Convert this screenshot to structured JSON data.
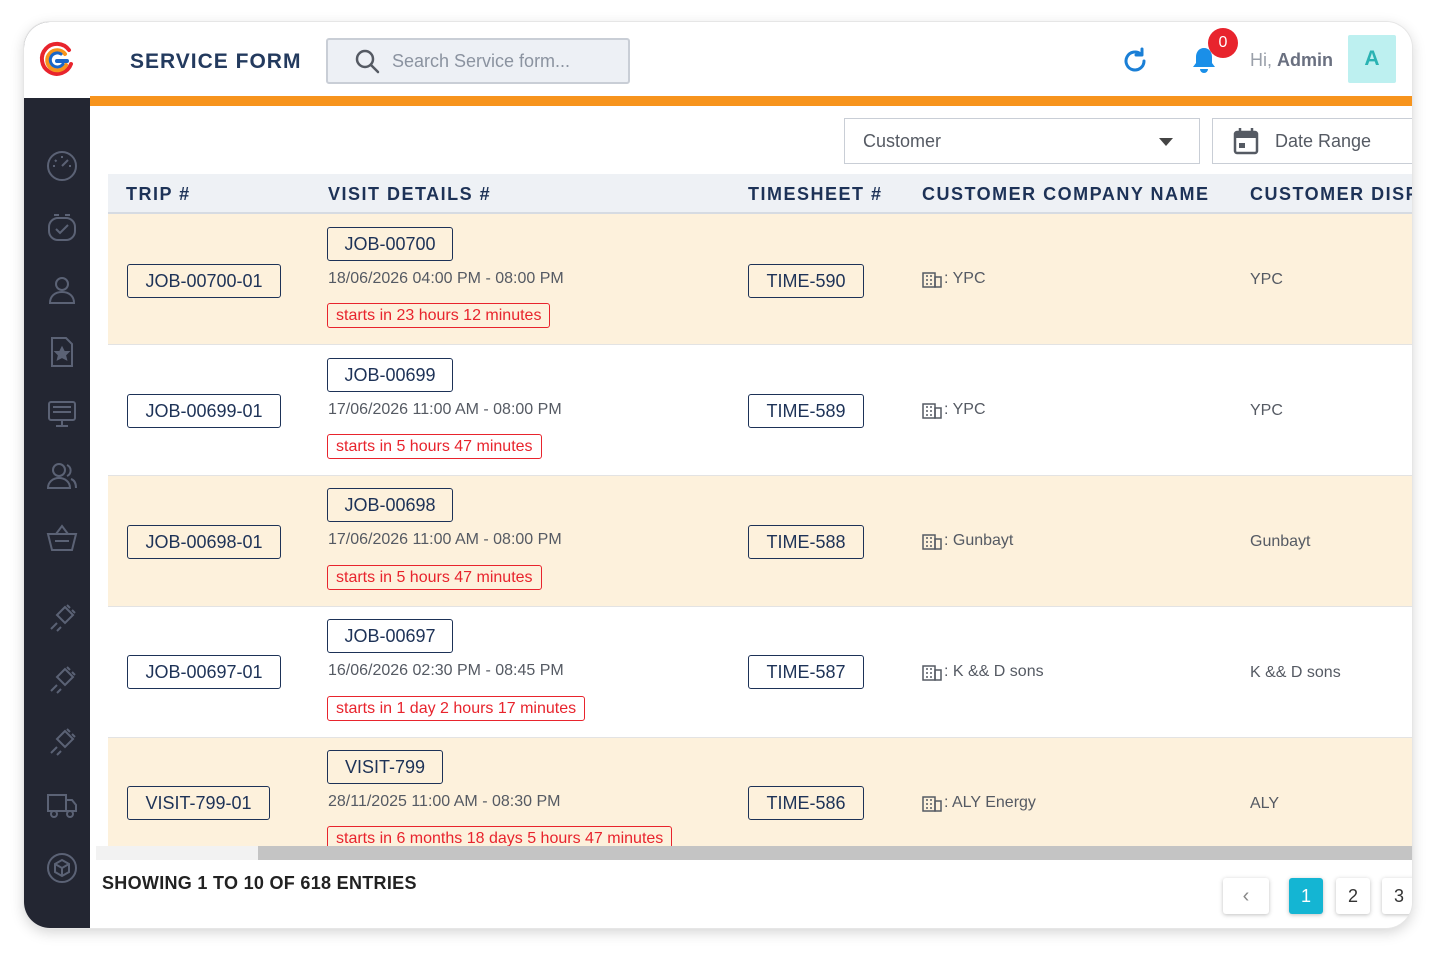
{
  "header": {
    "title": "SERVICE FORM",
    "search_placeholder": "Search Service form...",
    "notification_count": "0",
    "greeting": "Hi,",
    "user_name": "Admin",
    "avatar_letter": "A"
  },
  "sidebar": {
    "items": [
      {
        "icon": "dashboard-gauge-icon"
      },
      {
        "icon": "timer-check-icon"
      },
      {
        "icon": "user-icon"
      },
      {
        "icon": "star-document-icon"
      },
      {
        "icon": "monitor-icon"
      },
      {
        "icon": "users-icon"
      },
      {
        "icon": "basket-icon"
      },
      {
        "icon": "plug-icon"
      },
      {
        "icon": "plug-icon"
      },
      {
        "icon": "plug-icon"
      },
      {
        "icon": "truck-icon"
      },
      {
        "icon": "box-icon"
      }
    ]
  },
  "filters": {
    "customer_label": "Customer",
    "date_range_label": "Date Range"
  },
  "table": {
    "columns": [
      "TRIP #",
      "VISIT DETAILS #",
      "TIMESHEET #",
      "CUSTOMER COMPANY NAME",
      "CUSTOMER DISP"
    ],
    "rows": [
      {
        "trip": "JOB-00700-01",
        "visit": "JOB-00700",
        "when": "18/06/2026 04:00 PM - 08:00 PM",
        "starts": "starts in 23 hours 12 minutes",
        "timesheet": "TIME-590",
        "company": ": YPC",
        "display": "YPC"
      },
      {
        "trip": "JOB-00699-01",
        "visit": "JOB-00699",
        "when": "17/06/2026 11:00 AM - 08:00 PM",
        "starts": "starts in 5 hours 47 minutes",
        "timesheet": "TIME-589",
        "company": ": YPC",
        "display": "YPC"
      },
      {
        "trip": "JOB-00698-01",
        "visit": "JOB-00698",
        "when": "17/06/2026 11:00 AM - 08:00 PM",
        "starts": "starts in 5 hours 47 minutes",
        "timesheet": "TIME-588",
        "company": ": Gunbayt",
        "display": "Gunbayt"
      },
      {
        "trip": "JOB-00697-01",
        "visit": "JOB-00697",
        "when": "16/06/2026 02:30 PM - 08:45 PM",
        "starts": "starts in 1 day 2 hours 17 minutes",
        "timesheet": "TIME-587",
        "company": ": K && D sons",
        "display": "K && D sons"
      },
      {
        "trip": "VISIT-799-01",
        "visit": "VISIT-799",
        "when": "28/11/2025 11:00 AM - 08:30 PM",
        "starts": "starts in 6 months 18 days 5 hours 47 minutes",
        "timesheet": "TIME-586",
        "company": ": ALY Energy",
        "display": "ALY"
      }
    ]
  },
  "footer": {
    "showing": "SHOWING 1 TO 10 OF 618 ENTRIES",
    "prev_label": "‹",
    "pages": [
      "1",
      "2",
      "3"
    ],
    "active_page": "1"
  },
  "colors": {
    "accent_orange": "#f7941d",
    "sidebar": "#232632",
    "navy_text": "#1d3257",
    "row_highlight": "#fdf1dc",
    "alert_red": "#e8242d",
    "active_page": "#14b5d3"
  }
}
